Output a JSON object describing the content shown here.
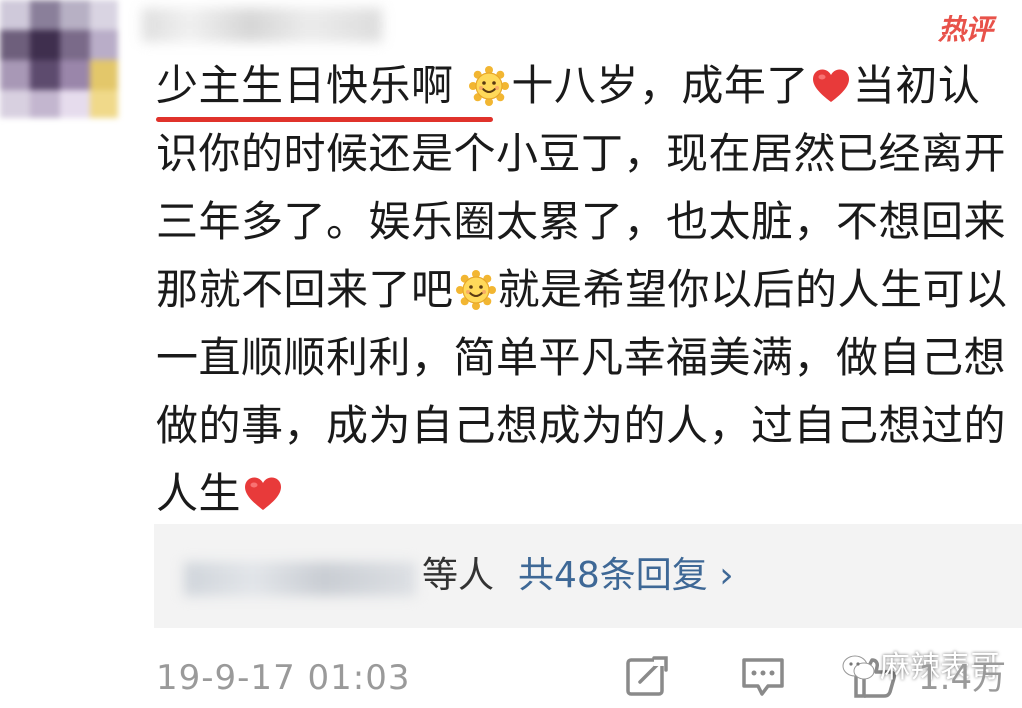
{
  "comment": {
    "badge": "热评",
    "highlight": "少主生日快乐啊",
    "segment_1": "十八岁，成年了",
    "segment_2": "当初认识你的时候还是个小豆丁，现在居然已经离开三年多了。娱乐圈太累了，也太脏，不想回来那就不回来了吧",
    "segment_3": "就是希望你以后的人生可以一直顺顺利利，简单平凡幸福美满，做自己想做的事，成为自己想成为的人，过自己想过的人生"
  },
  "replies": {
    "suffix": "等人",
    "link": "共48条回复 ›"
  },
  "footer": {
    "timestamp": "19-9-17 01:03",
    "watermark": "麻辣表哥",
    "like_count": "1.4万"
  },
  "icons": {
    "sun_emoji": "sun-face-emoji",
    "heart_emoji": "red-heart-emoji",
    "share": "share-edit-icon",
    "comment": "comment-bubble-icon",
    "like": "thumbs-up-icon",
    "wechat": "wechat-icon"
  },
  "colors": {
    "accent_red": "#e0322b",
    "link_blue": "#3e6896",
    "meta_gray": "#9a9a9a"
  }
}
